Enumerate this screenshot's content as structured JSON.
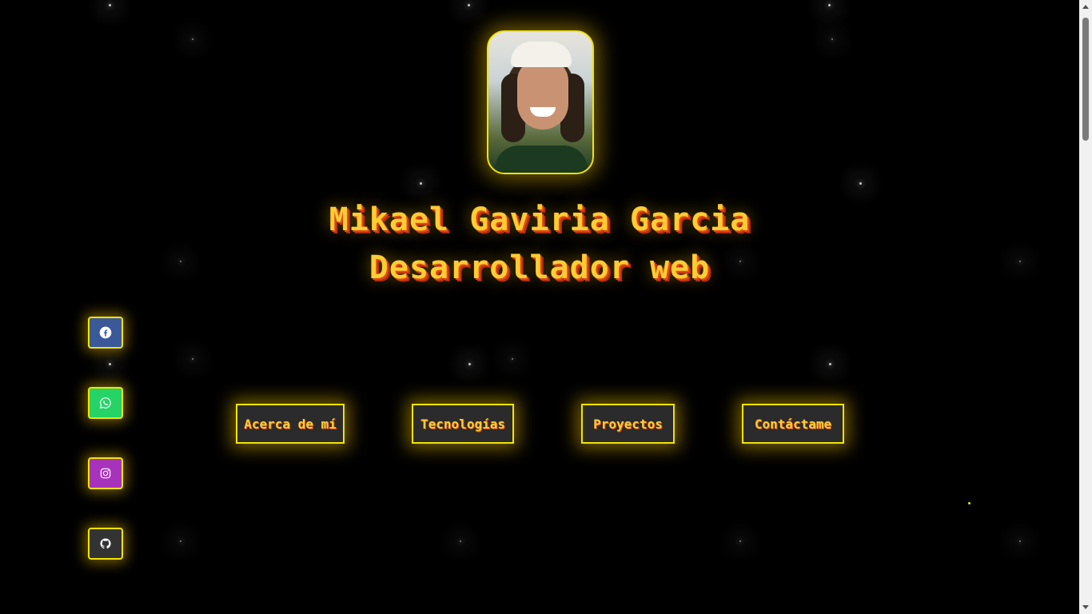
{
  "profile": {
    "name": "Mikael Gaviria Garcia",
    "role": "Desarrollador web",
    "photo_alt": "Foto de perfil"
  },
  "social_links": [
    {
      "network": "Facebook",
      "icon": "facebook-icon",
      "color": "#3b5998"
    },
    {
      "network": "WhatsApp",
      "icon": "whatsapp-icon",
      "color": "#25d366"
    },
    {
      "network": "Instagram",
      "icon": "instagram-icon",
      "color": "#a733bd"
    },
    {
      "network": "GitHub",
      "icon": "github-icon",
      "color": "#333333"
    }
  ],
  "navigation": {
    "about": "Acerca de mí",
    "technologies": "Tecnologías",
    "projects": "Proyectos",
    "contact": "Contáctame"
  },
  "theme": {
    "background": "#000000",
    "accent": "#f2e400",
    "text": "#ffcc33",
    "text_shadow": "#e04a1a"
  }
}
